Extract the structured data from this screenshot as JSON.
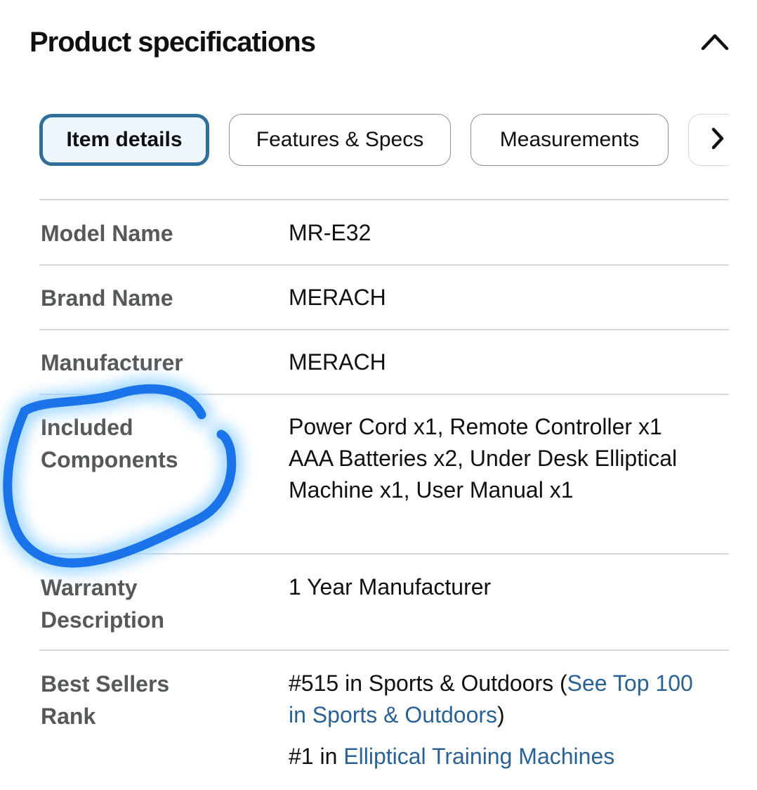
{
  "header": {
    "title": "Product specifications",
    "collapse_icon": "chevron-up-icon"
  },
  "tabs": [
    {
      "label": "Item details",
      "active": true
    },
    {
      "label": "Features & Specs",
      "active": false
    },
    {
      "label": "Measurements",
      "active": false
    }
  ],
  "tabs_next_icon": "chevron-right-icon",
  "specs": [
    {
      "label": "Model Name",
      "value": "MR-E32"
    },
    {
      "label": "Brand Name",
      "value": "MERACH"
    },
    {
      "label": "Manufacturer",
      "value": "MERACH"
    },
    {
      "label": "Included Components",
      "value": "Power Cord x1, Remote Controller x1 AAA Batteries x2, Under Desk Elliptical Machine x1, User Manual x1"
    },
    {
      "label": "Warranty Description",
      "value": "1 Year Manufacturer"
    }
  ],
  "best_sellers": {
    "label": "Best Sellers Rank",
    "rank1_prefix": "#515 in Sports & Outdoors (",
    "rank1_link": "See Top 100 in Sports & Outdoors",
    "rank1_suffix": ")",
    "rank2_prefix": "#1 in ",
    "rank2_link": "Elliptical Training Machines"
  },
  "annotation": {
    "type": "hand-drawn circle",
    "color": "#1a73e8",
    "glow_color": "#8fd0ff"
  },
  "colors": {
    "active_tab_border": "#2f6d9b",
    "active_tab_bg": "#edf6fb",
    "link": "#2a6295",
    "label": "#565959",
    "divider": "#d5d9d9"
  }
}
